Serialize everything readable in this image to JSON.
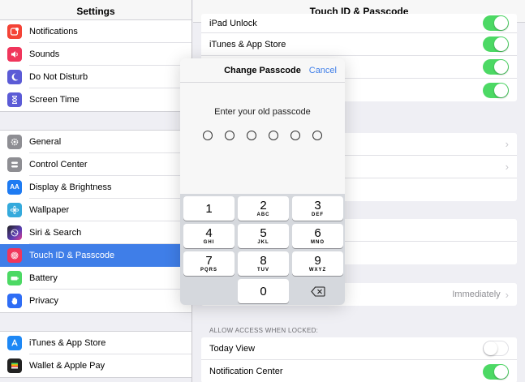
{
  "sidebar": {
    "title": "Settings",
    "groups": [
      [
        {
          "label": "Notifications",
          "icon": "notifications-icon",
          "color": "#f44336"
        },
        {
          "label": "Sounds",
          "icon": "sounds-icon",
          "color": "#f0365c"
        },
        {
          "label": "Do Not Disturb",
          "icon": "moon-icon",
          "color": "#5b5bd6"
        },
        {
          "label": "Screen Time",
          "icon": "hourglass-icon",
          "color": "#5b5bd6"
        }
      ],
      [
        {
          "label": "General",
          "icon": "gear-icon",
          "color": "#8e8e93"
        },
        {
          "label": "Control Center",
          "icon": "control-center-icon",
          "color": "#8e8e93"
        },
        {
          "label": "Display & Brightness",
          "icon": "display-icon",
          "color": "#1e7bf2"
        },
        {
          "label": "Wallpaper",
          "icon": "wallpaper-icon",
          "color": "#35aadc"
        },
        {
          "label": "Siri & Search",
          "icon": "siri-icon",
          "color": "#222"
        },
        {
          "label": "Touch ID & Passcode",
          "icon": "fingerprint-icon",
          "color": "#f0365c",
          "selected": true
        },
        {
          "label": "Battery",
          "icon": "battery-icon",
          "color": "#4cd964"
        },
        {
          "label": "Privacy",
          "icon": "hand-icon",
          "color": "#2f6df5"
        }
      ],
      [
        {
          "label": "iTunes & App Store",
          "icon": "app-store-icon",
          "color": "#1e88f5"
        },
        {
          "label": "Wallet & Apple Pay",
          "icon": "wallet-icon",
          "color": "#222"
        }
      ]
    ]
  },
  "detail": {
    "title": "Touch ID & Passcode",
    "toggles_top": [
      {
        "label": "iPad Unlock",
        "on": true
      },
      {
        "label": "iTunes & App Store",
        "on": true
      },
      {
        "label": "",
        "on": true
      },
      {
        "label": "",
        "on": true
      }
    ],
    "require_passcode_value": "Immediately",
    "allow_access_header": "ALLOW ACCESS WHEN LOCKED:",
    "allow_access": [
      {
        "label": "Today View",
        "on": false
      },
      {
        "label": "Notification Center",
        "on": true
      }
    ]
  },
  "modal": {
    "title": "Change Passcode",
    "cancel_label": "Cancel",
    "prompt": "Enter your old passcode",
    "dot_count": 6,
    "keys": [
      {
        "num": "1",
        "sub": ""
      },
      {
        "num": "2",
        "sub": "ABC"
      },
      {
        "num": "3",
        "sub": "DEF"
      },
      {
        "num": "4",
        "sub": "GHI"
      },
      {
        "num": "5",
        "sub": "JKL"
      },
      {
        "num": "6",
        "sub": "MNO"
      },
      {
        "num": "7",
        "sub": "PQRS"
      },
      {
        "num": "8",
        "sub": "TUV"
      },
      {
        "num": "9",
        "sub": "WXYZ"
      },
      {
        "num": "0",
        "sub": ""
      }
    ]
  }
}
